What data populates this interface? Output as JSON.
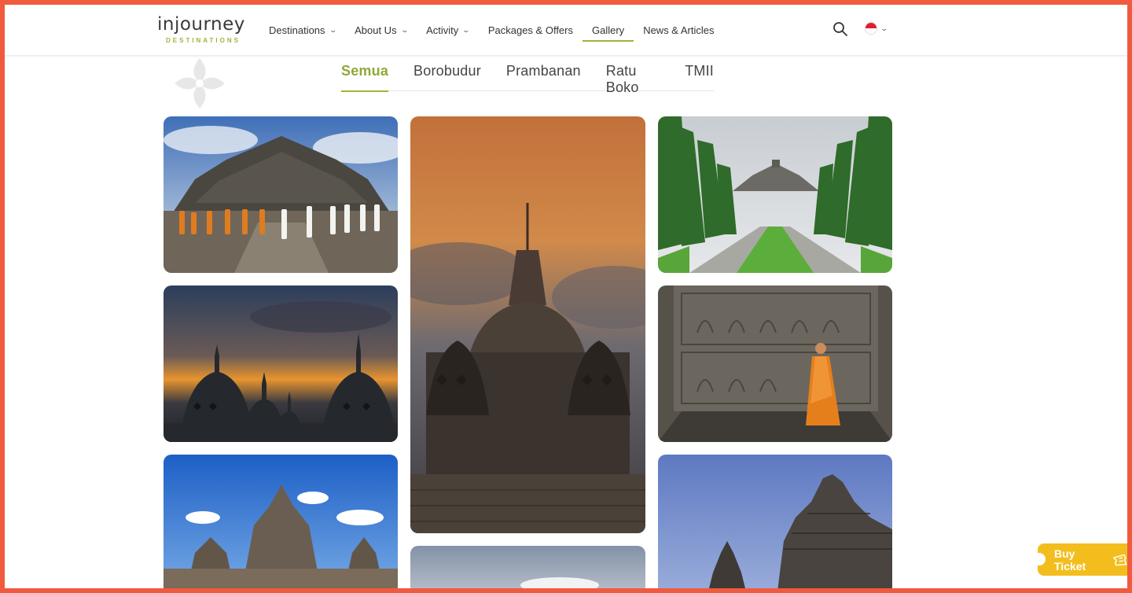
{
  "brand": {
    "name": "injourney",
    "tagline": "DESTINATIONS",
    "accent": "#9fb43b",
    "frame": "#f05a3e"
  },
  "nav": {
    "items": [
      {
        "label": "Destinations",
        "dropdown": true
      },
      {
        "label": "About Us",
        "dropdown": true
      },
      {
        "label": "Activity",
        "dropdown": true
      },
      {
        "label": "Packages & Offers",
        "dropdown": false
      },
      {
        "label": "Gallery",
        "dropdown": false,
        "active": true
      },
      {
        "label": "News & Articles",
        "dropdown": false
      }
    ],
    "search_icon": "search-icon",
    "language_flag": "indonesia-flag-icon"
  },
  "gallery": {
    "tabs": [
      {
        "label": "Semua",
        "active": true
      },
      {
        "label": "Borobudur"
      },
      {
        "label": "Prambanan"
      },
      {
        "label": "Ratu Boko"
      },
      {
        "label": "TMII"
      }
    ]
  },
  "cta": {
    "buy_ticket_label": "Buy Ticket",
    "color": "#f3be1d"
  }
}
